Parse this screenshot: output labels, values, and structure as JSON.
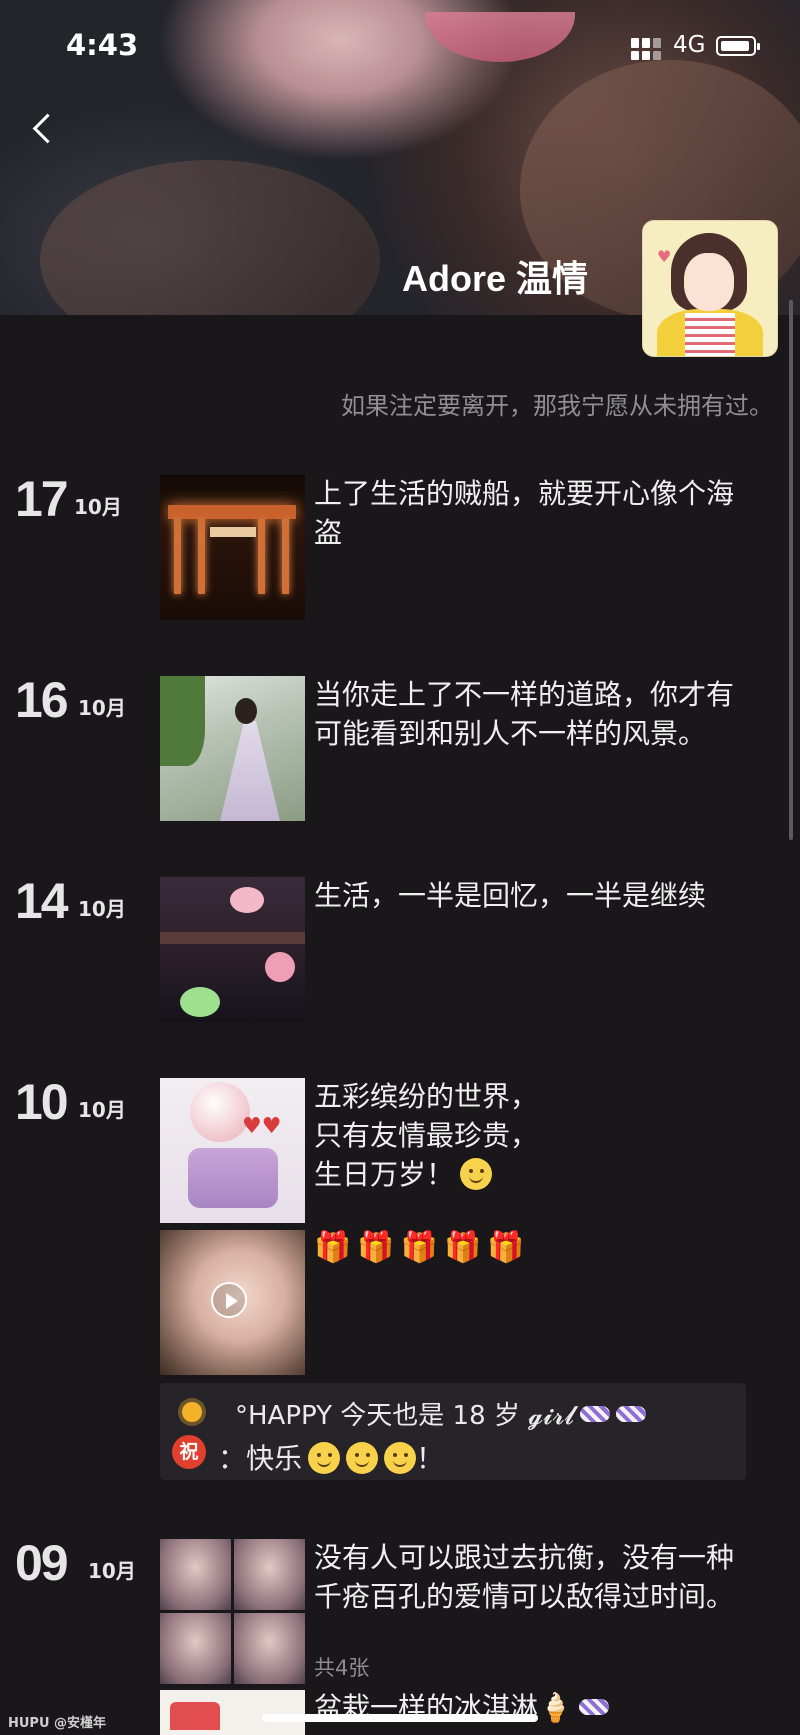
{
  "status_bar": {
    "time": "4:43",
    "network": "4G"
  },
  "profile": {
    "name": "Adore 温情",
    "signature": "如果注定要离开，那我宁愿从未拥有过。"
  },
  "posts": [
    {
      "day": "17",
      "month": "10月",
      "text": "上了生活的贼船，就要开心像个海盗"
    },
    {
      "day": "16",
      "month": "10月",
      "text": "当你走上了不一样的道路，你才有可能看到和别人不一样的风景。"
    },
    {
      "day": "14",
      "month": "10月",
      "text": "生活，一半是回忆，一半是继续"
    },
    {
      "day": "10",
      "month": "10月",
      "text_lines": [
        "五彩缤纷的世界，",
        "只有友情最珍贵，",
        "生日万岁！"
      ],
      "emoji_row": "🎁🎁🎁🎁🎁",
      "share": {
        "line1": "°HAPPY 今天也是 18 岁 𝓰𝓲𝓻𝓵",
        "badge": "祝",
        "line2": "：快乐",
        "line2_end": "！"
      }
    },
    {
      "day": "09",
      "month": "10月",
      "text": "没有人可以跟过去抗衡，没有一种千疮百孔的爱情可以敌得过时间。",
      "photo_count": "共4张"
    },
    {
      "text": "盆栽一样的冰淇淋🍦"
    }
  ],
  "watermark": "HUPU @安槿年",
  "icons": {
    "back": "chevron-left-icon",
    "play": "play-icon",
    "sun": "sun-icon",
    "candy": "candy-icon"
  }
}
